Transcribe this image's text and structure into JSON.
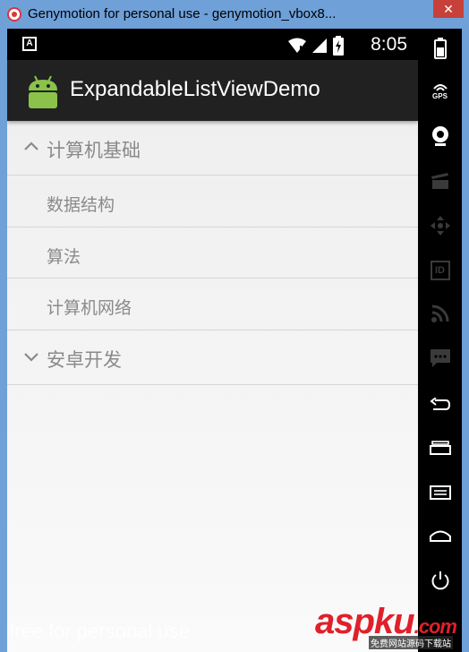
{
  "window": {
    "title": "Genymotion for personal use - genymotion_vbox8...",
    "close_glyph": "✕"
  },
  "statusbar": {
    "notification_glyph": "A",
    "time": "8:05"
  },
  "actionbar": {
    "title": "ExpandableListViewDemo",
    "logo_color": "#8bc34a"
  },
  "list": {
    "groups": [
      {
        "label": "计算机基础",
        "expanded": true,
        "children": [
          "数据结构",
          "算法",
          "计算机网络"
        ]
      },
      {
        "label": "安卓开发",
        "expanded": false,
        "children": []
      }
    ]
  },
  "sidepanel": {
    "buttons": [
      "battery-icon",
      "gps-icon",
      "webcam-icon",
      "screencast-icon",
      "dpad-icon",
      "id-icon",
      "rss-icon",
      "message-icon",
      "back-icon",
      "recent-apps-icon",
      "menu-icon",
      "home-icon",
      "power-icon"
    ],
    "gps_label": "GPS",
    "id_label": "ID"
  },
  "watermarks": {
    "free": "free for personal use",
    "aspku": "aspku",
    "aspku_tld": ".com",
    "aspku_sub": "免费网站源码下载站"
  },
  "colors": {
    "frame": "#6fa0d8",
    "actionbar": "#212121",
    "list_text": "#8a8a8a",
    "close_button": "#c7413a"
  }
}
